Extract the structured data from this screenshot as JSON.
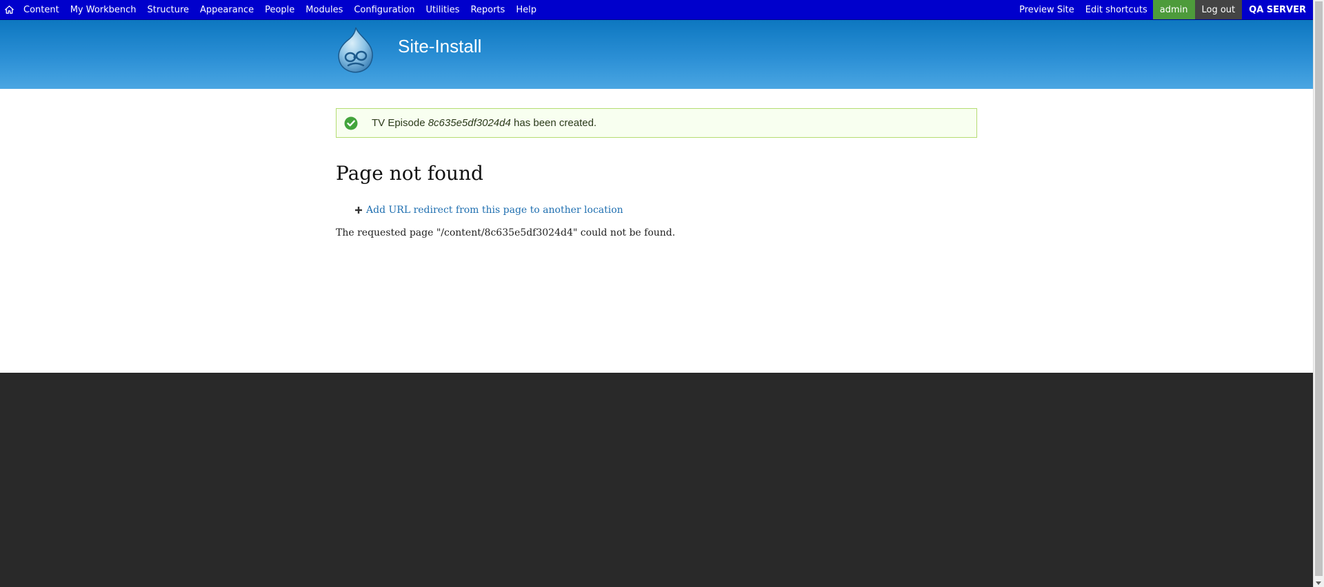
{
  "toolbar": {
    "home_icon": "home-icon",
    "menu": [
      "Content",
      "My Workbench",
      "Structure",
      "Appearance",
      "People",
      "Modules",
      "Configuration",
      "Utilities",
      "Reports",
      "Help"
    ],
    "preview_site": "Preview Site",
    "edit_shortcuts": "Edit shortcuts",
    "user": "admin",
    "logout": "Log out",
    "server": "QA SERVER"
  },
  "header": {
    "site_name": "Site-Install"
  },
  "status": {
    "prefix": "TV Episode",
    "node_title": "8c635e5df3024d4",
    "suffix": "has been created."
  },
  "page": {
    "title": "Page not found",
    "redirect_link": "Add URL redirect from this page to another location",
    "message": "The requested page \"/content/8c635e5df3024d4\" could not be found."
  },
  "colors": {
    "toolbar_bg": "#0000cc",
    "user_bg": "#4d9b3b",
    "logout_bg": "#444444",
    "header_top": "#0d77c0",
    "header_bottom": "#4aa6e2",
    "status_border": "#b4dc72",
    "link": "#1f6fb0",
    "footer_bg": "#292929"
  }
}
